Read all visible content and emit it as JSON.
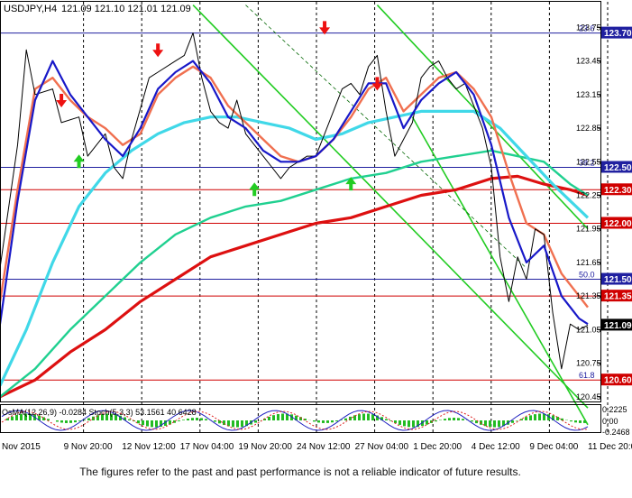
{
  "header": {
    "symbol": "USDJPY,H4",
    "ohlc": "121.09 121.10 121.01 121.09"
  },
  "chart_data": {
    "type": "line",
    "symbol": "USDJPY",
    "timeframe": "H4",
    "ylim": [
      120.4,
      123.85
    ],
    "grid": true,
    "x_labels": [
      "Nov 2015",
      "9 Nov 20:00",
      "12 Nov 12:00",
      "17 Nov 04:00",
      "19 Nov 20:00",
      "24 Nov 12:00",
      "27 Nov 04:00",
      "1 Dec 20:00",
      "4 Dec 12:00",
      "9 Dec 04:00",
      "11 Dec 20:00"
    ],
    "y_ticks": [
      123.75,
      123.45,
      123.15,
      122.85,
      122.55,
      122.25,
      121.95,
      121.65,
      121.35,
      121.05,
      120.75,
      120.45
    ],
    "levels": [
      {
        "price": 123.7,
        "label": "123.70",
        "color": "#2020a0",
        "note": "23.6"
      },
      {
        "price": 122.5,
        "label": "122.50",
        "color": "#2020a0",
        "note": "38.2"
      },
      {
        "price": 122.3,
        "label": "122.30",
        "color": "#d00000",
        "note": ""
      },
      {
        "price": 122.0,
        "label": "122.00",
        "color": "#d00000",
        "note": ""
      },
      {
        "price": 121.5,
        "label": "121.50",
        "color": "#2020a0",
        "note": "50.0"
      },
      {
        "price": 121.35,
        "label": "121.35",
        "color": "#d00000",
        "note": ""
      },
      {
        "price": 121.09,
        "label": "121.09",
        "color": "#000000",
        "note": ""
      },
      {
        "price": 120.6,
        "label": "120.60",
        "color": "#d00000",
        "note": "61.8"
      }
    ],
    "series": [
      {
        "name": "",
        "color": "#000000",
        "kind": "price",
        "points": [
          [
            0,
            121.6
          ],
          [
            2,
            122.7
          ],
          [
            3,
            123.55
          ],
          [
            4,
            123.15
          ],
          [
            6,
            123.2
          ],
          [
            7,
            122.9
          ],
          [
            9,
            122.95
          ],
          [
            10,
            122.6
          ],
          [
            12,
            122.8
          ],
          [
            13,
            122.5
          ],
          [
            14,
            122.4
          ],
          [
            15,
            122.75
          ],
          [
            17,
            123.3
          ],
          [
            18,
            123.35
          ],
          [
            20,
            123.45
          ],
          [
            21,
            123.5
          ],
          [
            22,
            123.7
          ],
          [
            23,
            123.3
          ],
          [
            24,
            123.0
          ],
          [
            25,
            122.9
          ],
          [
            26,
            122.85
          ],
          [
            27,
            123.1
          ],
          [
            28,
            122.8
          ],
          [
            29,
            122.7
          ],
          [
            30,
            122.6
          ],
          [
            31,
            122.5
          ],
          [
            32,
            122.4
          ],
          [
            33,
            122.5
          ],
          [
            34,
            122.55
          ],
          [
            35,
            122.6
          ],
          [
            36,
            122.6
          ],
          [
            37,
            122.8
          ],
          [
            38,
            123.0
          ],
          [
            39,
            123.2
          ],
          [
            40,
            123.25
          ],
          [
            41,
            123.15
          ],
          [
            42,
            123.4
          ],
          [
            43,
            123.5
          ],
          [
            44,
            123.0
          ],
          [
            45,
            122.6
          ],
          [
            46,
            122.75
          ],
          [
            47,
            122.9
          ],
          [
            48,
            123.3
          ],
          [
            49,
            123.4
          ],
          [
            50,
            123.45
          ],
          [
            51,
            123.3
          ],
          [
            52,
            123.2
          ],
          [
            53,
            123.25
          ],
          [
            54,
            123.05
          ],
          [
            55,
            122.85
          ],
          [
            56,
            122.5
          ],
          [
            57,
            121.7
          ],
          [
            58,
            121.3
          ],
          [
            59,
            121.7
          ],
          [
            60,
            121.5
          ],
          [
            61,
            121.95
          ],
          [
            62,
            121.9
          ],
          [
            63,
            121.2
          ],
          [
            64,
            120.7
          ],
          [
            65,
            121.1
          ],
          [
            66,
            121.05
          ],
          [
            67,
            121.09
          ]
        ]
      },
      {
        "name": "",
        "color": "#1818c8",
        "kind": "fast-ma",
        "points": [
          [
            0,
            121.1
          ],
          [
            2,
            122.2
          ],
          [
            4,
            123.1
          ],
          [
            6,
            123.45
          ],
          [
            8,
            123.15
          ],
          [
            10,
            122.95
          ],
          [
            12,
            122.75
          ],
          [
            14,
            122.6
          ],
          [
            16,
            122.85
          ],
          [
            18,
            123.2
          ],
          [
            20,
            123.35
          ],
          [
            22,
            123.45
          ],
          [
            24,
            123.25
          ],
          [
            26,
            122.95
          ],
          [
            28,
            122.85
          ],
          [
            30,
            122.65
          ],
          [
            32,
            122.55
          ],
          [
            34,
            122.55
          ],
          [
            36,
            122.6
          ],
          [
            38,
            122.75
          ],
          [
            40,
            123.0
          ],
          [
            42,
            123.25
          ],
          [
            44,
            123.25
          ],
          [
            46,
            122.85
          ],
          [
            48,
            123.1
          ],
          [
            50,
            123.25
          ],
          [
            52,
            123.35
          ],
          [
            54,
            123.15
          ],
          [
            56,
            122.7
          ],
          [
            58,
            122.05
          ],
          [
            60,
            121.65
          ],
          [
            62,
            121.8
          ],
          [
            64,
            121.35
          ],
          [
            66,
            121.15
          ],
          [
            67,
            121.1
          ]
        ]
      },
      {
        "name": "",
        "color": "#f07050",
        "kind": "mid-ma",
        "points": [
          [
            0,
            121.3
          ],
          [
            2,
            122.3
          ],
          [
            4,
            123.2
          ],
          [
            6,
            123.3
          ],
          [
            8,
            123.1
          ],
          [
            10,
            122.95
          ],
          [
            12,
            122.85
          ],
          [
            14,
            122.7
          ],
          [
            16,
            122.8
          ],
          [
            18,
            123.15
          ],
          [
            20,
            123.3
          ],
          [
            22,
            123.4
          ],
          [
            24,
            123.3
          ],
          [
            26,
            123.05
          ],
          [
            28,
            122.9
          ],
          [
            30,
            122.75
          ],
          [
            32,
            122.6
          ],
          [
            34,
            122.55
          ],
          [
            36,
            122.6
          ],
          [
            38,
            122.75
          ],
          [
            40,
            122.95
          ],
          [
            42,
            123.2
          ],
          [
            44,
            123.3
          ],
          [
            46,
            123.0
          ],
          [
            48,
            123.15
          ],
          [
            50,
            123.3
          ],
          [
            52,
            123.35
          ],
          [
            54,
            123.2
          ],
          [
            56,
            122.95
          ],
          [
            58,
            122.45
          ],
          [
            60,
            122.0
          ],
          [
            62,
            121.9
          ],
          [
            64,
            121.55
          ],
          [
            66,
            121.35
          ],
          [
            67,
            121.25
          ]
        ]
      },
      {
        "name": "",
        "color": "#40d8e8",
        "kind": "ma-100",
        "points": [
          [
            0,
            120.55
          ],
          [
            3,
            121.05
          ],
          [
            6,
            121.65
          ],
          [
            9,
            122.15
          ],
          [
            12,
            122.45
          ],
          [
            15,
            122.65
          ],
          [
            18,
            122.8
          ],
          [
            21,
            122.9
          ],
          [
            24,
            122.95
          ],
          [
            27,
            122.95
          ],
          [
            30,
            122.9
          ],
          [
            33,
            122.85
          ],
          [
            36,
            122.75
          ],
          [
            39,
            122.8
          ],
          [
            42,
            122.9
          ],
          [
            45,
            122.95
          ],
          [
            48,
            123.0
          ],
          [
            51,
            123.0
          ],
          [
            54,
            123.0
          ],
          [
            57,
            122.85
          ],
          [
            60,
            122.6
          ],
          [
            63,
            122.35
          ],
          [
            65,
            122.2
          ],
          [
            67,
            122.05
          ]
        ]
      },
      {
        "name": "",
        "color": "#20d090",
        "kind": "ma-200",
        "points": [
          [
            0,
            120.45
          ],
          [
            4,
            120.7
          ],
          [
            8,
            121.05
          ],
          [
            12,
            121.35
          ],
          [
            16,
            121.65
          ],
          [
            20,
            121.9
          ],
          [
            24,
            122.05
          ],
          [
            28,
            122.15
          ],
          [
            32,
            122.2
          ],
          [
            36,
            122.3
          ],
          [
            40,
            122.4
          ],
          [
            44,
            122.45
          ],
          [
            48,
            122.55
          ],
          [
            52,
            122.6
          ],
          [
            56,
            122.65
          ],
          [
            59,
            122.6
          ],
          [
            62,
            122.55
          ],
          [
            65,
            122.35
          ],
          [
            67,
            122.25
          ]
        ]
      },
      {
        "name": "",
        "color": "#dd1010",
        "kind": "ma-slow",
        "points": [
          [
            0,
            120.45
          ],
          [
            4,
            120.6
          ],
          [
            8,
            120.85
          ],
          [
            12,
            121.05
          ],
          [
            16,
            121.3
          ],
          [
            20,
            121.5
          ],
          [
            24,
            121.7
          ],
          [
            28,
            121.8
          ],
          [
            32,
            121.9
          ],
          [
            36,
            122.0
          ],
          [
            40,
            122.05
          ],
          [
            44,
            122.15
          ],
          [
            48,
            122.25
          ],
          [
            52,
            122.3
          ],
          [
            56,
            122.4
          ],
          [
            59,
            122.42
          ],
          [
            62,
            122.35
          ],
          [
            65,
            122.3
          ],
          [
            67,
            122.25
          ]
        ]
      }
    ],
    "oscillator": {
      "label": "OsMA(12,26,9) -0.0284  Stoch(5,3,3) 53.1561 40.6428",
      "ticks": [
        "0.2225",
        "0.00",
        "-0.2468"
      ]
    }
  },
  "footnote": "The figures refer to the past and past performance is not a reliable indicator of future results."
}
